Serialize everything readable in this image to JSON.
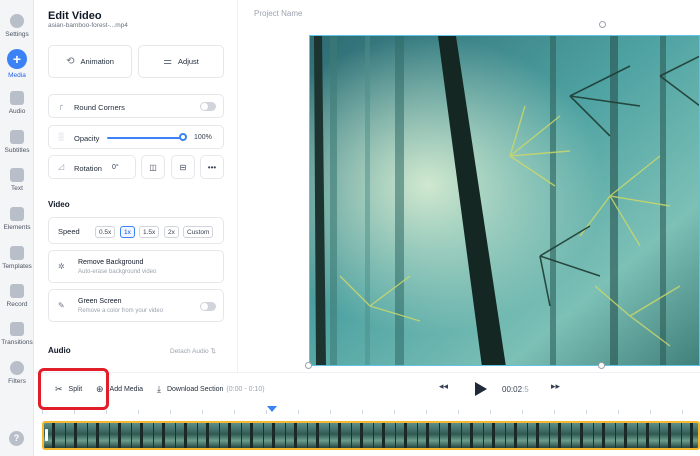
{
  "rail": {
    "items": [
      {
        "label": "Settings",
        "icon": "gear-icon"
      },
      {
        "label": "Media",
        "icon": "plus-icon",
        "active": true
      },
      {
        "label": "Audio",
        "icon": "music-icon"
      },
      {
        "label": "Subtitles",
        "icon": "subtitles-icon"
      },
      {
        "label": "Text",
        "icon": "text-icon"
      },
      {
        "label": "Elements",
        "icon": "elements-icon"
      },
      {
        "label": "Templates",
        "icon": "templates-icon"
      },
      {
        "label": "Record",
        "icon": "record-icon"
      },
      {
        "label": "Transitions",
        "icon": "transitions-icon"
      },
      {
        "label": "Filters",
        "icon": "filters-icon"
      }
    ],
    "help": "?"
  },
  "panel": {
    "title": "Edit Video",
    "filename": "asian-bamboo-forest-...mp4",
    "animation_label": "Animation",
    "adjust_label": "Adjust",
    "round_corners_label": "Round Corners",
    "opacity_label": "Opacity",
    "opacity_value": "100%",
    "opacity_level": 1.0,
    "rotation_label": "Rotation",
    "rotation_value": "0°",
    "more_label": "•••",
    "video_section": "Video",
    "speed_label": "Speed",
    "speed_options": [
      "0.5x",
      "1x",
      "1.5x",
      "2x",
      "Custom"
    ],
    "speed_selected": "1x",
    "remove_bg_title": "Remove Background",
    "remove_bg_sub": "Auto-erase background video",
    "green_screen_title": "Green Screen",
    "green_screen_sub": "Remove a color from your video",
    "audio_section": "Audio",
    "detach_audio": "Detach Audio"
  },
  "canvas": {
    "project_name": "Project Name"
  },
  "toolbar": {
    "split_label": "Split",
    "add_media_label": "Add Media",
    "download_label": "Download Section",
    "download_range": "(0:00 - 0:10)",
    "time_main": "00:02",
    "time_frac": ":5",
    "rewind": "◂◂",
    "forward": "▸▸"
  },
  "colors": {
    "accent": "#3b82f6",
    "highlight": "#e11d2a",
    "timeline_border": "#f5b82e"
  }
}
